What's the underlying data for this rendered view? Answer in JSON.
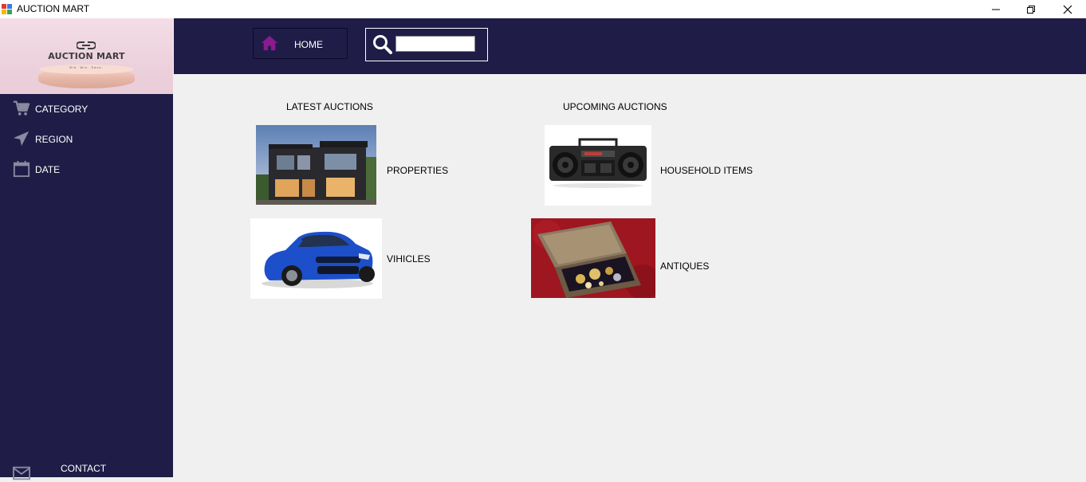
{
  "window": {
    "title": "AUCTION MART"
  },
  "logo": {
    "name": "AUCTION MART",
    "tagline": "Bid. Win. Save."
  },
  "sidebar": {
    "items": [
      {
        "label": "CATEGORY",
        "icon": "cart-icon"
      },
      {
        "label": "REGION",
        "icon": "location-arrow-icon"
      },
      {
        "label": "DATE",
        "icon": "calendar-icon"
      }
    ],
    "contact": {
      "label": "CONTACT",
      "icon": "envelope-icon"
    }
  },
  "topbar": {
    "home_label": "HOME",
    "home_icon": "home-icon",
    "search": {
      "value": "",
      "placeholder": "",
      "icon": "search-icon"
    }
  },
  "main": {
    "latest": {
      "heading": "LATEST AUCTIONS",
      "items": [
        {
          "label": "PROPERTIES",
          "image": "house-photo"
        },
        {
          "label": "VIHICLES",
          "image": "car-photo"
        }
      ]
    },
    "upcoming": {
      "heading": "UPCOMING AUCTIONS",
      "items": [
        {
          "label": "HOUSEHOLD ITEMS",
          "image": "boombox-photo"
        },
        {
          "label": "ANTIQUES",
          "image": "jewelry-box-photo"
        }
      ]
    }
  },
  "colors": {
    "nav_bg": "#1f1d47",
    "home_icon": "#8b1a8f",
    "content_bg": "#f0f0f0"
  }
}
